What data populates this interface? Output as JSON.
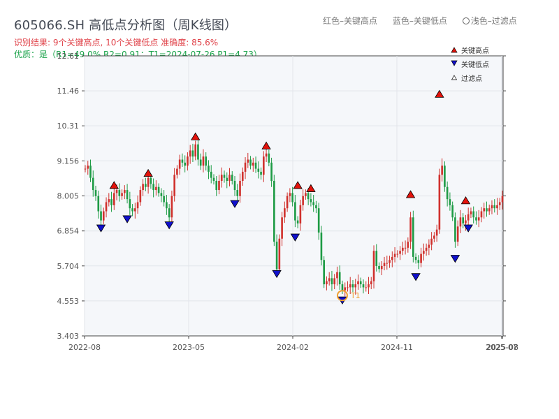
{
  "title": "605066.SH 高低点分析图（周K线图）",
  "info_line1": "识别结果: 9个关键高点, 10个关键低点  准确度: 85.6%",
  "info_line2": "优质：是（R1=49.0%  R2=0.91；T1=2024-07-26 P1=4.73）",
  "top_legend": {
    "red": "红色–关键高点",
    "blue": "蓝色–关键低点",
    "light": "浅色–过滤点"
  },
  "colors": {
    "up": "#d0312d",
    "down": "#1e9b45",
    "high": "#e3120b",
    "low": "#1010cc",
    "t1": "#f0a030"
  },
  "chart_data": {
    "type": "candlestick",
    "title": "605066.SH 高低点分析图（周K线图）",
    "y_ticks": [
      "3.403",
      "4.553",
      "5.704",
      "6.854",
      "8.005",
      "9.156",
      "10.31",
      "11.46",
      "12.61"
    ],
    "ylim": [
      3.403,
      12.61
    ],
    "x_ticks": [
      "2022-08",
      "2023-05",
      "2024-02",
      "2024-11",
      "2025-07",
      "2025-08"
    ],
    "grid": true,
    "t1_label": "T1",
    "series_path": [
      [
        0,
        8.9
      ],
      [
        1,
        9.0
      ],
      [
        2,
        8.6
      ],
      [
        3,
        8.2
      ],
      [
        4,
        8.0
      ],
      [
        5,
        7.5
      ],
      [
        6,
        7.2
      ],
      [
        7,
        7.5
      ],
      [
        8,
        7.8
      ],
      [
        9,
        7.9
      ],
      [
        10,
        7.7
      ],
      [
        11,
        8.1
      ],
      [
        12,
        8.2
      ],
      [
        13,
        8.0
      ],
      [
        14,
        8.1
      ],
      [
        15,
        8.2
      ],
      [
        16,
        7.9
      ],
      [
        17,
        7.6
      ],
      [
        18,
        7.5
      ],
      [
        19,
        7.6
      ],
      [
        20,
        7.8
      ],
      [
        21,
        8.2
      ],
      [
        22,
        8.4
      ],
      [
        23,
        8.3
      ],
      [
        24,
        8.6
      ],
      [
        25,
        8.4
      ],
      [
        26,
        8.2
      ],
      [
        27,
        8.3
      ],
      [
        28,
        8.1
      ],
      [
        29,
        8.0
      ],
      [
        30,
        7.8
      ],
      [
        31,
        7.6
      ],
      [
        32,
        7.3
      ],
      [
        33,
        8.0
      ],
      [
        34,
        8.7
      ],
      [
        35,
        8.9
      ],
      [
        36,
        9.2
      ],
      [
        37,
        9.1
      ],
      [
        38,
        9.0
      ],
      [
        39,
        9.3
      ],
      [
        40,
        9.5
      ],
      [
        41,
        9.3
      ],
      [
        42,
        9.7
      ],
      [
        43,
        9.2
      ],
      [
        44,
        9.0
      ],
      [
        45,
        9.3
      ],
      [
        46,
        9.0
      ],
      [
        47,
        8.8
      ],
      [
        48,
        8.6
      ],
      [
        49,
        8.5
      ],
      [
        50,
        8.2
      ],
      [
        51,
        8.5
      ],
      [
        52,
        8.7
      ],
      [
        53,
        8.6
      ],
      [
        54,
        8.5
      ],
      [
        55,
        8.7
      ],
      [
        56,
        8.5
      ],
      [
        57,
        8.2
      ],
      [
        58,
        8.0
      ],
      [
        59,
        8.5
      ],
      [
        60,
        8.8
      ],
      [
        61,
        9.1
      ],
      [
        62,
        9.2
      ],
      [
        63,
        9.0
      ],
      [
        64,
        9.1
      ],
      [
        65,
        8.9
      ],
      [
        66,
        8.8
      ],
      [
        67,
        8.7
      ],
      [
        68,
        9.3
      ],
      [
        69,
        9.4
      ],
      [
        70,
        9.1
      ],
      [
        71,
        8.5
      ],
      [
        72,
        6.5
      ],
      [
        73,
        5.6
      ],
      [
        74,
        6.6
      ],
      [
        75,
        7.3
      ],
      [
        76,
        7.6
      ],
      [
        77,
        8.0
      ],
      [
        78,
        8.1
      ],
      [
        79,
        7.8
      ],
      [
        80,
        7.2
      ],
      [
        81,
        7.1
      ],
      [
        82,
        7.7
      ],
      [
        83,
        8.0
      ],
      [
        84,
        8.1
      ],
      [
        85,
        7.9
      ],
      [
        86,
        7.8
      ],
      [
        87,
        7.7
      ],
      [
        88,
        7.6
      ],
      [
        89,
        6.8
      ],
      [
        90,
        5.9
      ],
      [
        91,
        5.1
      ],
      [
        92,
        5.2
      ],
      [
        93,
        5.3
      ],
      [
        94,
        5.1
      ],
      [
        95,
        5.3
      ],
      [
        96,
        5.5
      ],
      [
        97,
        5.1
      ],
      [
        98,
        4.9
      ],
      [
        99,
        5.0
      ],
      [
        100,
        5.0
      ],
      [
        101,
        5.1
      ],
      [
        102,
        5.0
      ],
      [
        103,
        5.1
      ],
      [
        104,
        5.2
      ],
      [
        105,
        5.1
      ],
      [
        106,
        5.0
      ],
      [
        107,
        5.0
      ],
      [
        108,
        5.1
      ],
      [
        109,
        5.2
      ],
      [
        110,
        6.2
      ],
      [
        111,
        5.7
      ],
      [
        112,
        5.6
      ],
      [
        113,
        5.7
      ],
      [
        114,
        5.8
      ],
      [
        115,
        5.8
      ],
      [
        116,
        5.9
      ],
      [
        117,
        6.0
      ],
      [
        118,
        6.1
      ],
      [
        119,
        6.1
      ],
      [
        120,
        6.2
      ],
      [
        121,
        6.3
      ],
      [
        122,
        6.3
      ],
      [
        123,
        6.5
      ],
      [
        124,
        7.3
      ],
      [
        125,
        6.0
      ],
      [
        126,
        5.9
      ],
      [
        127,
        5.8
      ],
      [
        128,
        6.1
      ],
      [
        129,
        6.2
      ],
      [
        130,
        6.3
      ],
      [
        131,
        6.4
      ],
      [
        132,
        6.6
      ],
      [
        133,
        6.7
      ],
      [
        134,
        6.9
      ],
      [
        135,
        8.7
      ],
      [
        136,
        9.0
      ],
      [
        137,
        8.3
      ],
      [
        138,
        7.9
      ],
      [
        139,
        7.7
      ],
      [
        140,
        7.3
      ],
      [
        141,
        6.5
      ],
      [
        142,
        7.0
      ],
      [
        143,
        7.3
      ],
      [
        144,
        7.1
      ],
      [
        145,
        7.2
      ],
      [
        146,
        7.4
      ],
      [
        147,
        7.5
      ],
      [
        148,
        7.3
      ],
      [
        149,
        7.2
      ],
      [
        150,
        7.3
      ],
      [
        151,
        7.5
      ],
      [
        152,
        7.6
      ],
      [
        153,
        7.5
      ],
      [
        154,
        7.6
      ],
      [
        155,
        7.7
      ],
      [
        156,
        7.6
      ],
      [
        157,
        7.7
      ],
      [
        158,
        7.8
      ],
      [
        159,
        8.0
      ]
    ],
    "key_highs": [
      {
        "i": 11,
        "v": 8.2
      },
      {
        "i": 24,
        "v": 8.6
      },
      {
        "i": 42,
        "v": 9.8
      },
      {
        "i": 69,
        "v": 9.5
      },
      {
        "i": 81,
        "v": 8.2
      },
      {
        "i": 86,
        "v": 8.1
      },
      {
        "i": 124,
        "v": 7.9
      },
      {
        "i": 135,
        "v": 11.2
      },
      {
        "i": 145,
        "v": 7.7
      }
    ],
    "key_lows": [
      {
        "i": 6,
        "v": 7.1
      },
      {
        "i": 16,
        "v": 7.4
      },
      {
        "i": 32,
        "v": 7.2
      },
      {
        "i": 57,
        "v": 7.9
      },
      {
        "i": 73,
        "v": 5.6
      },
      {
        "i": 80,
        "v": 6.8
      },
      {
        "i": 98,
        "v": 4.73
      },
      {
        "i": 126,
        "v": 5.5
      },
      {
        "i": 141,
        "v": 6.1
      },
      {
        "i": 146,
        "v": 7.1
      }
    ],
    "t1": {
      "date": "2024-07-26",
      "value": 4.73
    },
    "legend": [
      {
        "label": "关键高点",
        "marker": "up"
      },
      {
        "label": "关键低点",
        "marker": "down"
      },
      {
        "label": "过滤点",
        "marker": "up-hollow"
      }
    ]
  }
}
